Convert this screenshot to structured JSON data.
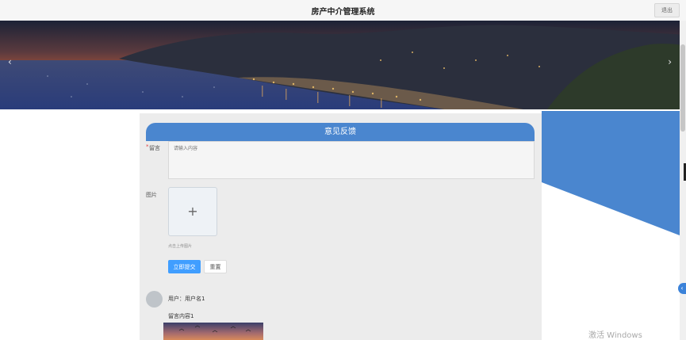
{
  "header": {
    "title": "房产中介管理系统",
    "logout_label": "退出"
  },
  "banner": {
    "prev_icon": "‹",
    "next_icon": "›",
    "slide_count": 3,
    "active_slide": 1
  },
  "feedback": {
    "title": "意见反馈",
    "message_label": "留言",
    "message_placeholder": "请输入内容",
    "image_label": "图片",
    "upload_hint": "点击上传图片",
    "submit_label": "立即提交",
    "reset_label": "重置"
  },
  "comments": [
    {
      "user": "用户：用户名1",
      "content": "留言内容1"
    }
  ],
  "side_tab_icon": "‹",
  "watermark": "激活 Windows",
  "colors": {
    "accent": "#4a86cf",
    "primary_button": "#409eff"
  }
}
